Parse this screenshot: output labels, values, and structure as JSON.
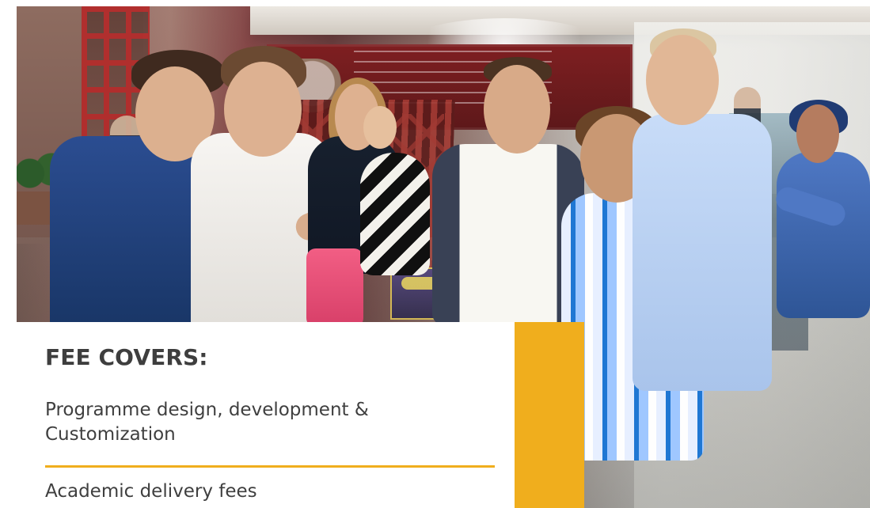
{
  "fee_section": {
    "title": "FEE COVERS:",
    "items": [
      "Programme design, development & Customization",
      "Academic delivery fees"
    ]
  },
  "colors": {
    "accent": "#f0ae1d",
    "text": "#3e3e3e",
    "panel": "#ffffff"
  }
}
